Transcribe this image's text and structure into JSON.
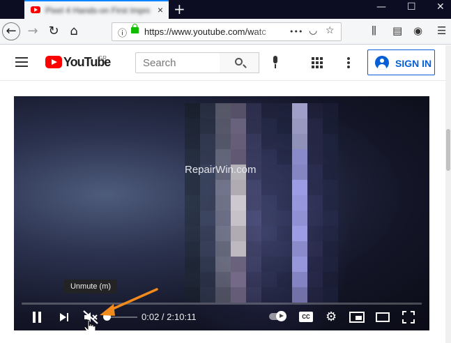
{
  "browser": {
    "tab_title": "Pixel 4 Hands-on First Impressions",
    "tab_close": "×",
    "new_tab": "+",
    "window_controls": [
      "—",
      "☐",
      "✕"
    ],
    "url": "https://www.youtube.com/watc",
    "nav": {
      "back": "←",
      "forward": "→",
      "reload": "↻",
      "home": "⌂",
      "info": "ⓘ",
      "page_actions": "•••",
      "pocket": "◡",
      "bookmark": "☆",
      "library": "⫼",
      "sidebar": "▤",
      "account": "◉",
      "menu": "☰"
    }
  },
  "youtube": {
    "logo_text": "YouTube",
    "region": "GR",
    "search_placeholder": "Search",
    "sign_in": "SIGN IN"
  },
  "player": {
    "watermark": "RepairWin.com",
    "tooltip": "Unmute (m)",
    "time": "0:02 / 2:10:11",
    "cc_label": "CC",
    "settings_glyph": "⚙",
    "progress_fraction": 0.0003,
    "muted": true,
    "autoplay": true
  },
  "colors": {
    "youtube_red": "#ff0000",
    "link_blue": "#065fd4",
    "annotation_arrow": "#f28a1c",
    "firefox_tab_accent": "#0a84ff"
  }
}
